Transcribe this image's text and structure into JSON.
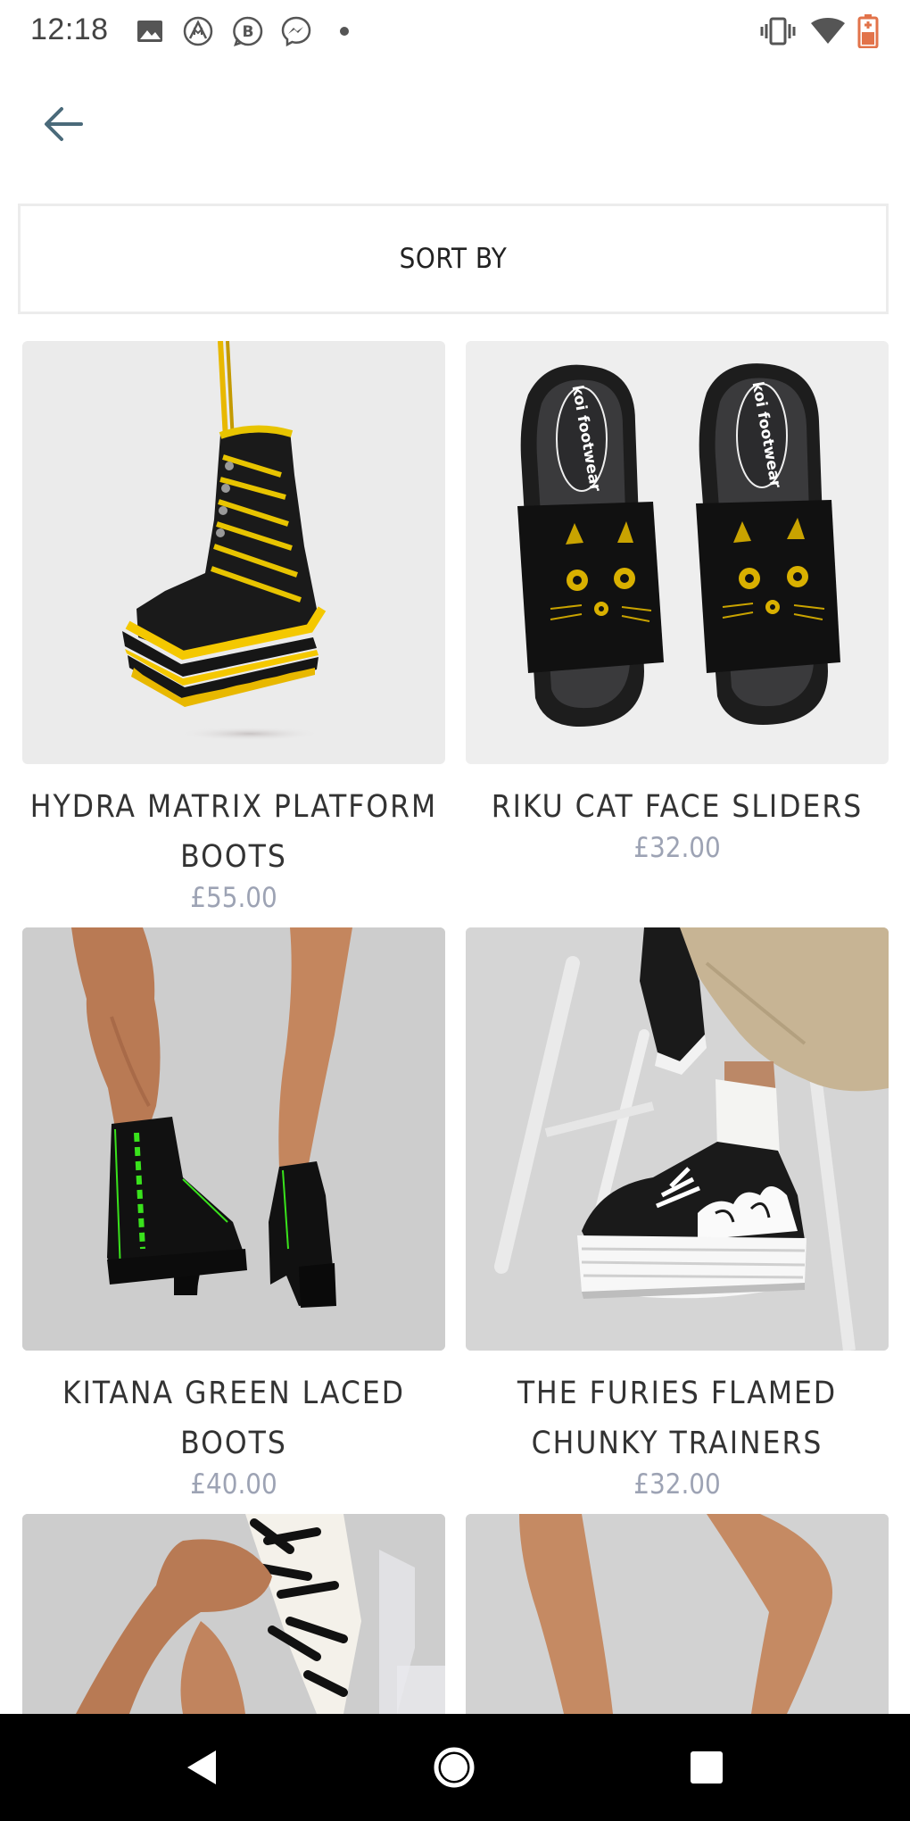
{
  "status_bar": {
    "time": "12:18",
    "left_icons": [
      "image-icon",
      "brand-m-icon",
      "b-icon",
      "messenger-icon",
      "dot-icon"
    ],
    "right_icons": [
      "vibrate-icon",
      "wifi-icon",
      "battery-icon"
    ]
  },
  "header": {
    "back_icon": "arrow-left-icon"
  },
  "sort": {
    "label": "SORT BY"
  },
  "products": [
    {
      "name": "HYDRA MATRIX PLATFORM BOOTS",
      "price": "£55.00"
    },
    {
      "name": "RIKU CAT FACE SLIDERS",
      "price": "£32.00"
    },
    {
      "name": "KITANA GREEN LACED BOOTS",
      "price": "£40.00"
    },
    {
      "name": "THE FURIES FLAMED CHUNKY TRAINERS",
      "price": "£32.00"
    }
  ],
  "slider_insole_text": "koi footwear",
  "nav_bar": {
    "buttons": [
      "back-triangle-icon",
      "home-circle-icon",
      "recents-square-icon"
    ]
  },
  "colors": {
    "price": "#9da3b4",
    "back_arrow": "#4a6a7a",
    "battery": "#e2734a",
    "nav_bar": "#000000"
  }
}
